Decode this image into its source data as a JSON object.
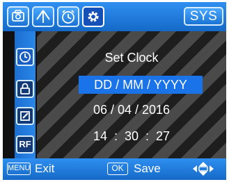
{
  "top_tabs": [
    {
      "icon": "camera-icon",
      "active": false
    },
    {
      "icon": "tree-icon",
      "active": false
    },
    {
      "icon": "timer-icon",
      "active": false
    },
    {
      "icon": "gear-icon",
      "active": true
    }
  ],
  "sys_label": "SYS",
  "sidebar": [
    {
      "icon": "clock-icon",
      "active": true
    },
    {
      "icon": "lock-icon",
      "active": false
    },
    {
      "icon": "edit-icon",
      "active": false
    },
    {
      "label": "RF",
      "active": false
    }
  ],
  "main": {
    "title": "Set Clock",
    "date_format": "DD / MM / YYYY",
    "date_value": "06 / 04 / 2016",
    "time_value": "14  :  30  :  27"
  },
  "footer": {
    "menu_key": "MENU",
    "menu_action": "Exit",
    "ok_key": "OK",
    "ok_action": "Save",
    "nav_icon": "four-way-arrows-icon"
  },
  "colors": {
    "accent": "#1a73e8",
    "bar": "#1f7fe0"
  }
}
